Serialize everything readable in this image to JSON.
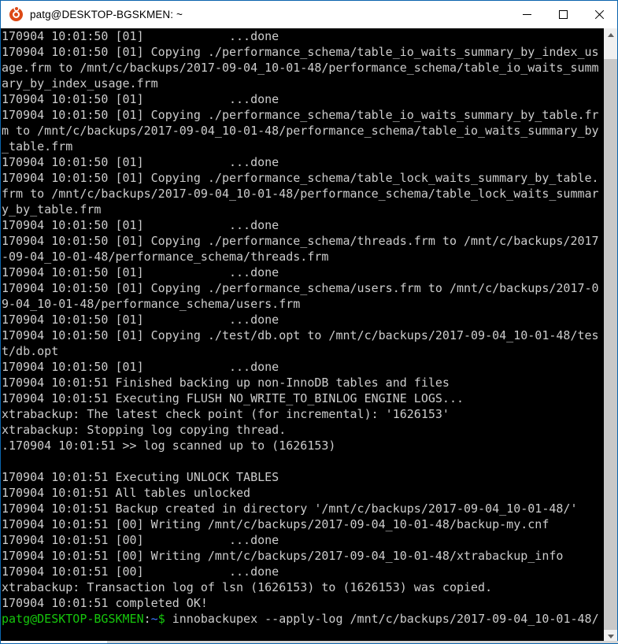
{
  "window": {
    "title": "patg@DESKTOP-BGSKMEN: ~",
    "icon": "ubuntu-logo-icon",
    "accent_color": "#0a64ad",
    "background_color": "#000000",
    "foreground_color": "#cccccc",
    "prompt_color": "#16c60c",
    "path_color": "#3b78ff"
  },
  "titlebar": {
    "minimize_label": "—",
    "maximize_label": "□",
    "close_label": "✕"
  },
  "scrollbar": {
    "up_label": "∧",
    "down_label": "∨"
  },
  "terminal": {
    "lines": [
      "170904 10:01:50 [01]            ...done",
      "170904 10:01:50 [01] Copying ./performance_schema/table_io_waits_summary_by_index_us",
      "age.frm to /mnt/c/backups/2017-09-04_10-01-48/performance_schema/table_io_waits_summ",
      "ary_by_index_usage.frm",
      "170904 10:01:50 [01]            ...done",
      "170904 10:01:50 [01] Copying ./performance_schema/table_io_waits_summary_by_table.fr",
      "m to /mnt/c/backups/2017-09-04_10-01-48/performance_schema/table_io_waits_summary_by",
      "_table.frm",
      "170904 10:01:50 [01]            ...done",
      "170904 10:01:50 [01] Copying ./performance_schema/table_lock_waits_summary_by_table.",
      "frm to /mnt/c/backups/2017-09-04_10-01-48/performance_schema/table_lock_waits_summar",
      "y_by_table.frm",
      "170904 10:01:50 [01]            ...done",
      "170904 10:01:50 [01] Copying ./performance_schema/threads.frm to /mnt/c/backups/2017",
      "-09-04_10-01-48/performance_schema/threads.frm",
      "170904 10:01:50 [01]            ...done",
      "170904 10:01:50 [01] Copying ./performance_schema/users.frm to /mnt/c/backups/2017-0",
      "9-04_10-01-48/performance_schema/users.frm",
      "170904 10:01:50 [01]            ...done",
      "170904 10:01:50 [01] Copying ./test/db.opt to /mnt/c/backups/2017-09-04_10-01-48/tes",
      "t/db.opt",
      "170904 10:01:50 [01]            ...done",
      "170904 10:01:51 Finished backing up non-InnoDB tables and files",
      "170904 10:01:51 Executing FLUSH NO_WRITE_TO_BINLOG ENGINE LOGS...",
      "xtrabackup: The latest check point (for incremental): '1626153'",
      "xtrabackup: Stopping log copying thread.",
      ".170904 10:01:51 >> log scanned up to (1626153)",
      "",
      "170904 10:01:51 Executing UNLOCK TABLES",
      "170904 10:01:51 All tables unlocked",
      "170904 10:01:51 Backup created in directory '/mnt/c/backups/2017-09-04_10-01-48/'",
      "170904 10:01:51 [00] Writing /mnt/c/backups/2017-09-04_10-01-48/backup-my.cnf",
      "170904 10:01:51 [00]            ...done",
      "170904 10:01:51 [00] Writing /mnt/c/backups/2017-09-04_10-01-48/xtrabackup_info",
      "170904 10:01:51 [00]            ...done",
      "xtrabackup: Transaction log of lsn (1626153) to (1626153) was copied.",
      "170904 10:01:51 completed OK!"
    ],
    "prompt": {
      "user_host": "patg@DESKTOP-BGSKMEN",
      "separator": ":",
      "path": "~",
      "dollar": "$",
      "command": " innobackupex --apply-log /mnt/c/backups/2017-09-04_10-01-48/"
    }
  }
}
